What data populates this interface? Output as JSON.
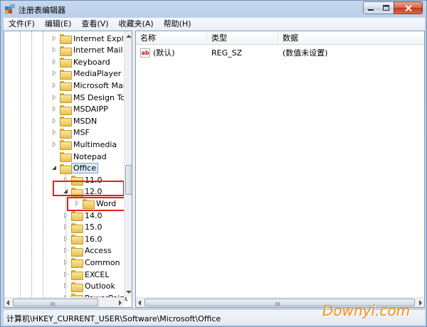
{
  "window": {
    "title": "注册表编辑器",
    "app_icon": "regedit-icon",
    "buttons": {
      "minimize": "minimize-icon",
      "maximize": "maximize-icon",
      "close": "close-icon"
    }
  },
  "menu": {
    "items": [
      "文件(F)",
      "编辑(E)",
      "查看(V)",
      "收藏夹(A)",
      "帮助(H)"
    ]
  },
  "tree": {
    "items": [
      {
        "label": "Internet Explor",
        "level": 1,
        "expander": "closed"
      },
      {
        "label": "Internet Mail a",
        "level": 1,
        "expander": "closed"
      },
      {
        "label": "Keyboard",
        "level": 1,
        "expander": "closed"
      },
      {
        "label": "MediaPlayer",
        "level": 1,
        "expander": "closed"
      },
      {
        "label": "Microsoft Mar",
        "level": 1,
        "expander": "closed"
      },
      {
        "label": "MS Design Too",
        "level": 1,
        "expander": "closed"
      },
      {
        "label": "MSDAIPP",
        "level": 1,
        "expander": "closed"
      },
      {
        "label": "MSDN",
        "level": 1,
        "expander": "closed"
      },
      {
        "label": "MSF",
        "level": 1,
        "expander": "closed"
      },
      {
        "label": "Multimedia",
        "level": 1,
        "expander": "closed"
      },
      {
        "label": "Notepad",
        "level": 1,
        "expander": "none"
      },
      {
        "label": "Office",
        "level": 1,
        "expander": "open",
        "selected": true
      },
      {
        "label": "11.0",
        "level": 2,
        "expander": "closed"
      },
      {
        "label": "12.0",
        "level": 2,
        "expander": "open"
      },
      {
        "label": "Word",
        "level": 3,
        "expander": "closed"
      },
      {
        "label": "14.0",
        "level": 2,
        "expander": "closed"
      },
      {
        "label": "15.0",
        "level": 2,
        "expander": "closed"
      },
      {
        "label": "16.0",
        "level": 2,
        "expander": "closed"
      },
      {
        "label": "Access",
        "level": 2,
        "expander": "closed"
      },
      {
        "label": "Common",
        "level": 2,
        "expander": "closed"
      },
      {
        "label": "EXCEL",
        "level": 2,
        "expander": "closed"
      },
      {
        "label": "Outlook",
        "level": 2,
        "expander": "closed"
      },
      {
        "label": "PowerPoint",
        "level": 2,
        "expander": "closed"
      }
    ],
    "scroll_grip": "III"
  },
  "list": {
    "columns": [
      "名称",
      "类型",
      "数据"
    ],
    "rows": [
      {
        "icon": "ab",
        "name": "(默认)",
        "type": "REG_SZ",
        "data": "(数值未设置)"
      }
    ],
    "scroll_grip": "III"
  },
  "status": {
    "path": "计算机\\HKEY_CURRENT_USER\\Software\\Microsoft\\Office"
  },
  "watermark": "Downyi.com",
  "colors": {
    "highlight_box": "#e02020",
    "watermark": "#f09018"
  }
}
